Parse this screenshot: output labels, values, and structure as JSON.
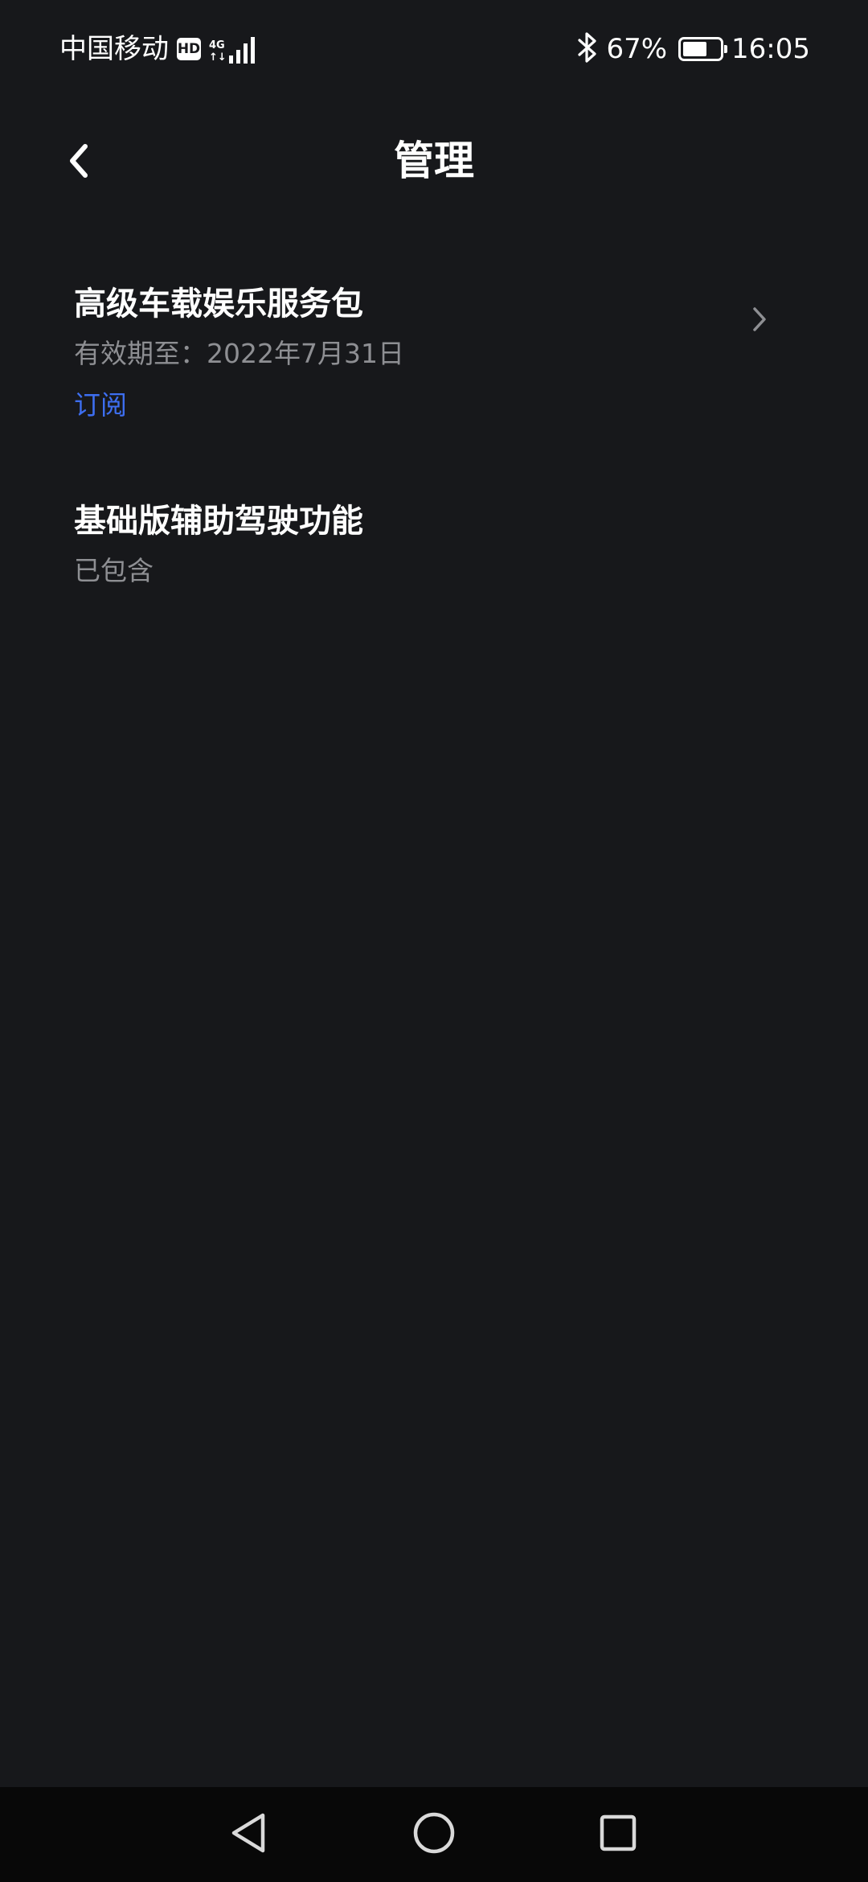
{
  "status_bar": {
    "carrier": "中国移动",
    "hd_badge": "HD",
    "network_type_top": "4G",
    "network_type_bottom": "↑↓",
    "signal_level_of_4": 4,
    "battery_percent_text": "67%",
    "battery_level_fraction": 0.67,
    "time": "16:05",
    "icons": [
      "bluetooth-icon",
      "battery-icon",
      "signal-icon"
    ]
  },
  "header": {
    "title": "管理",
    "back_icon": "chevron-left-icon"
  },
  "list": {
    "items": [
      {
        "title": "高级车载娱乐服务包",
        "subtitle": "有效期至：2022年7月31日",
        "link": "订阅",
        "has_chevron": true
      },
      {
        "title": "基础版辅助驾驶功能",
        "subtitle": "已包含"
      }
    ]
  },
  "nav_bar": {
    "icons": [
      "nav-back-triangle-icon",
      "nav-home-circle-icon",
      "nav-recents-square-icon"
    ]
  },
  "colors": {
    "background": "#17181b",
    "text_primary": "#ffffff",
    "text_secondary": "#8e8f93",
    "accent_link": "#3d6ef0",
    "nav_bar_background": "#080808"
  }
}
